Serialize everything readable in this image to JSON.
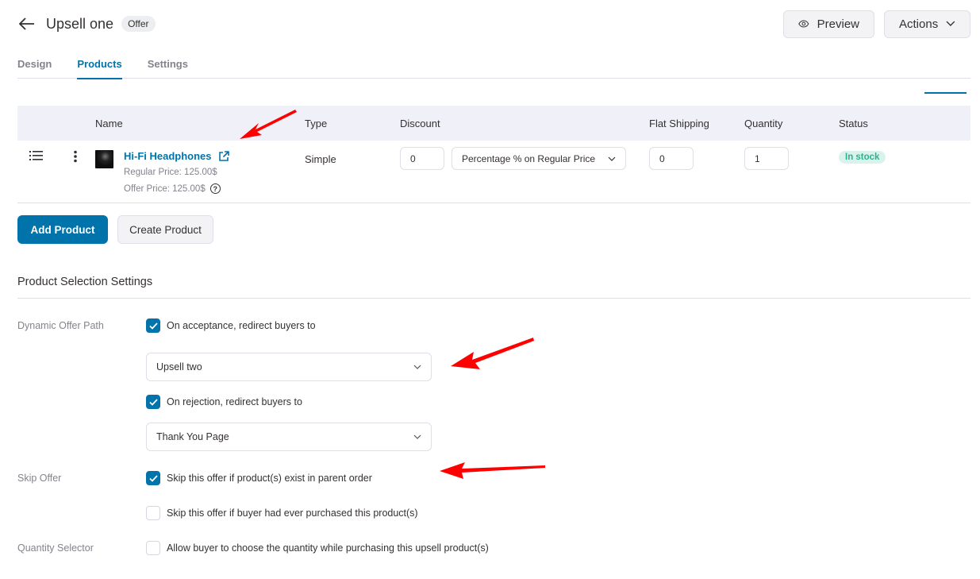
{
  "header": {
    "title": "Upsell one",
    "badge": "Offer",
    "preview_label": "Preview",
    "actions_label": "Actions"
  },
  "tabs": [
    {
      "label": "Design",
      "active": false
    },
    {
      "label": "Products",
      "active": true
    },
    {
      "label": "Settings",
      "active": false
    }
  ],
  "table": {
    "columns": [
      "Name",
      "Type",
      "Discount",
      "Flat Shipping",
      "Quantity",
      "Status"
    ],
    "rows": [
      {
        "name": "Hi-Fi Headphones",
        "regular_price": "Regular Price: 125.00$",
        "offer_price": "Offer Price: 125.00$",
        "type": "Simple",
        "discount_value": "0",
        "discount_type": "Percentage % on Regular Price",
        "flat_shipping": "0",
        "quantity": "1",
        "status": "In stock"
      }
    ]
  },
  "buttons": {
    "add_product": "Add Product",
    "create_product": "Create Product"
  },
  "settings": {
    "title": "Product Selection Settings",
    "dynamic_offer_path": {
      "label": "Dynamic Offer Path",
      "on_accept": {
        "label": "On acceptance, redirect buyers to",
        "checked": true,
        "selected": "Upsell two"
      },
      "on_reject": {
        "label": "On rejection, redirect buyers to",
        "checked": true,
        "selected": "Thank You Page"
      }
    },
    "skip_offer": {
      "label": "Skip Offer",
      "options": [
        {
          "label": "Skip this offer if product(s) exist in parent order",
          "checked": true
        },
        {
          "label": "Skip this offer if buyer had ever purchased this product(s)",
          "checked": false
        }
      ]
    },
    "quantity_selector": {
      "label": "Quantity Selector",
      "option": {
        "label": "Allow buyer to choose the quantity while purchasing this upsell product(s)",
        "checked": false
      }
    }
  },
  "colors": {
    "accent": "#0073aa",
    "annotation_arrow": "#ff0000",
    "stock_badge_bg": "#d9f3ec",
    "stock_badge_text": "#2ab28f"
  }
}
